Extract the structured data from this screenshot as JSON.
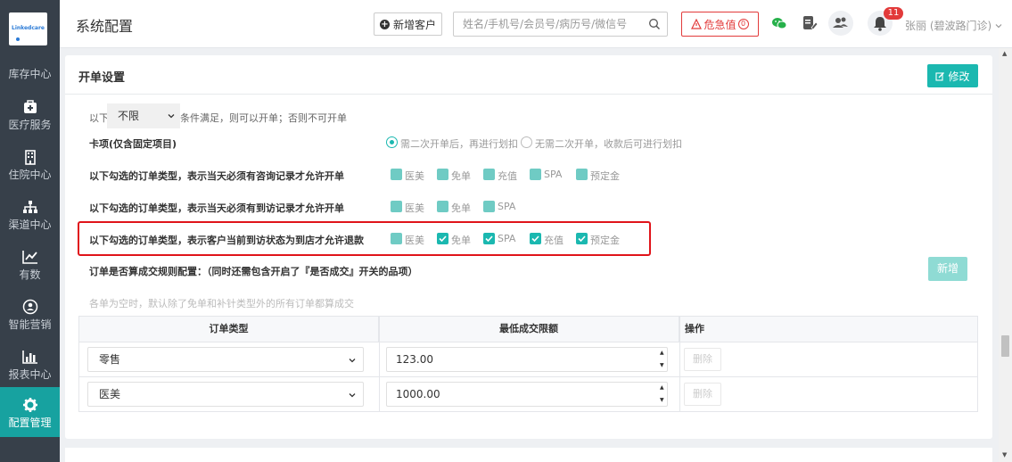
{
  "sidebar": {
    "logo_text": "Linkedcare",
    "items": [
      {
        "label": "库存中心",
        "icon": "inventory-icon"
      },
      {
        "label": "医疗服务",
        "icon": "medical-kit-icon"
      },
      {
        "label": "住院中心",
        "icon": "building-icon"
      },
      {
        "label": "渠道中心",
        "icon": "sitemap-icon"
      },
      {
        "label": "有数",
        "icon": "line-chart-icon"
      },
      {
        "label": "智能营销",
        "icon": "users-icon"
      },
      {
        "label": "报表中心",
        "icon": "bar-chart-icon"
      },
      {
        "label": "配置管理",
        "icon": "gear-icon",
        "active": true
      }
    ]
  },
  "header": {
    "title": "系统配置",
    "new_customer_label": "新增客户",
    "search_placeholder": "姓名/手机号/会员号/病历号/微信号",
    "critical_label": "危急值",
    "critical_count": "0",
    "notification_count": "11",
    "user_name": "张丽 (碧波路门诊)"
  },
  "panel": {
    "title": "开单设置",
    "edit_label": "修改",
    "limit_prefix": "以下",
    "limit_select": "不限",
    "limit_suffix": "条件满足，则可以开单；否则不可开单",
    "card_item_label": "卡项(仅含固定项目)",
    "card_option_1": "需二次开单后，再进行划扣",
    "card_option_2": "无需二次开单，收款后可进行划扣",
    "row1_label": "以下勾选的订单类型，表示当天必须有咨询记录才允许开单",
    "row1_options": [
      "医美",
      "免单",
      "充值",
      "SPA",
      "预定金"
    ],
    "row2_label": "以下勾选的订单类型，表示当天必须有到访记录才允许开单",
    "row2_options": [
      "医美",
      "免单",
      "SPA"
    ],
    "row3_label": "以下勾选的订单类型，表示客户当前到访状态为到店才允许退款",
    "row3_options": [
      "医美",
      "免单",
      "SPA",
      "充值",
      "预定金"
    ],
    "row3_checked": [
      false,
      true,
      true,
      true,
      true
    ],
    "rule_label": "订单是否算成交规则配置：（同时还需包含开启了『是否成交』开关的品项）",
    "add_label": "新增",
    "hint": "各单为空时，默认除了免单和补针类型外的所有订单都算成交"
  },
  "table": {
    "headers": [
      "订单类型",
      "最低成交限额",
      "操作"
    ],
    "rows": [
      {
        "type": "零售",
        "amount": "123.00",
        "action": "删除"
      },
      {
        "type": "医美",
        "amount": "1000.00",
        "action": "删除"
      }
    ]
  },
  "colors": {
    "accent": "#1bb8b0",
    "sidebar_bg": "#37404a",
    "danger": "#e23a3a"
  }
}
